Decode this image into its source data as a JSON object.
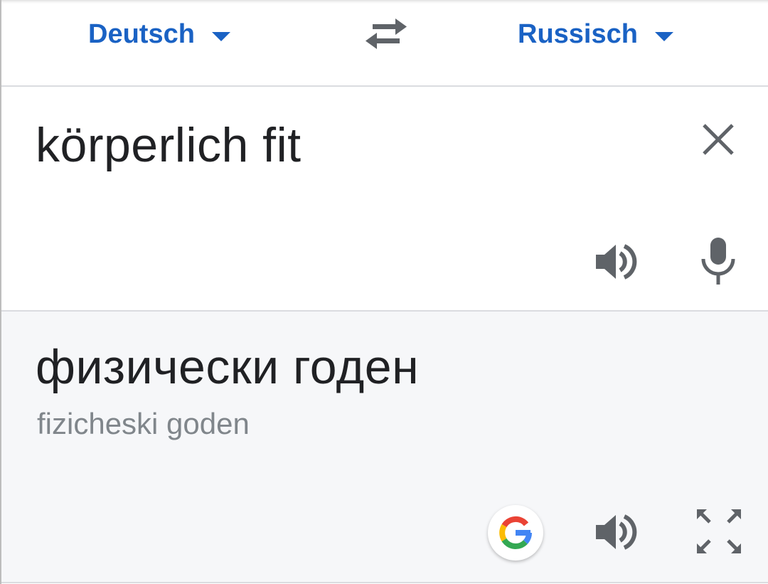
{
  "language_bar": {
    "source_language": "Deutsch",
    "target_language": "Russisch",
    "swap_icon": "swap-arrows-icon"
  },
  "input": {
    "text": "körperlich fit",
    "clear_icon": "close-icon",
    "speaker_icon": "speaker-icon",
    "mic_icon": "microphone-icon"
  },
  "output": {
    "translation": "физически годен",
    "transliteration": "fizicheski goden",
    "google_icon": "google-g-icon",
    "speaker_icon": "speaker-icon",
    "fullscreen_icon": "fullscreen-icon"
  },
  "colors": {
    "accent": "#1a62c4",
    "text": "#202124",
    "secondary_text": "#80868b",
    "icon": "#5f6368",
    "output_bg": "#f6f7f9"
  }
}
